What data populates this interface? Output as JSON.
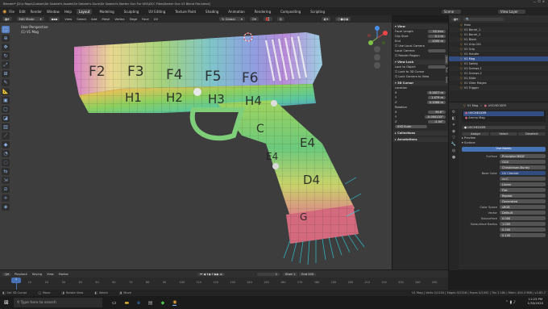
{
  "window": {
    "title": "Blender* [D:\\z Repo\\Custom\\Sir Gabriel's Assets\\Sir Gabriel's Guns\\Sir Gabriel's Starter Gun For UE4\\DCC Files\\Starter Gun V1 Blend File.blend]"
  },
  "menu": {
    "items": [
      "File",
      "Edit",
      "Render",
      "Window",
      "Help"
    ],
    "workspaces": [
      "Layout",
      "Modeling",
      "Sculpting",
      "UV Editing",
      "Texture Paint",
      "Shading",
      "Animation",
      "Rendering",
      "Compositing",
      "Scripting"
    ],
    "active_workspace": "Layout",
    "scene": "Scene",
    "view_layer": "View Layer"
  },
  "viewport_header": {
    "mode": "Edit Mode",
    "items": [
      "View",
      "Select",
      "Add",
      "Mesh",
      "Vertex",
      "Edge",
      "Face",
      "UV"
    ],
    "orientation": "Global"
  },
  "viewport": {
    "view_name": "User Perspective",
    "object_name": "(1) V1 Mag",
    "uv_labels": [
      "F2",
      "F3",
      "F4",
      "F5",
      "F6",
      "H1",
      "H2",
      "H3",
      "H4",
      "C",
      "E4",
      "D4",
      "E4",
      "G"
    ]
  },
  "npanel": {
    "view_section": "View",
    "focal_length_label": "Focal Length",
    "focal_length": "50 mm",
    "clip_start_label": "Clip Start",
    "clip_start": "0.1 m",
    "clip_end_label": "End",
    "clip_end": "1000 m",
    "local_camera_label": "Use Local Camera",
    "local_camera_field": "Local Camera",
    "render_region": "Render Region",
    "view_lock_section": "View Lock",
    "lock_to_object_label": "Lock to Object",
    "lock_3d_cursor": "Lock to 3D Cursor",
    "lock_camera_view": "Lock Camera to View",
    "cursor_section": "3D Cursor",
    "location_label": "Location",
    "loc": [
      [
        "X",
        "0.1827 m"
      ],
      [
        "Y",
        "1.479 m"
      ],
      [
        "Z",
        "0.1088 m"
      ]
    ],
    "rotation_label": "Rotation",
    "rot": [
      [
        "X",
        "90.8°"
      ],
      [
        "Y",
        "-0.000133°"
      ],
      [
        "Z",
        "-2.04°"
      ]
    ],
    "rotation_mode": "XYZ Euler",
    "collections": "Collections",
    "annotations": "Annotations",
    "tabs": [
      "Item",
      "Tool",
      "View"
    ]
  },
  "outliner": {
    "items": [
      "Halo",
      "V1 Barrel_1",
      "V1 Barrel_2",
      "V1 Block",
      "V1 Grip.001",
      "V1 Grip",
      "V1 Handle",
      "V1 Mag",
      "V1 Safety",
      "V1 Screws.1",
      "V1 Screws.2",
      "V1 Slide",
      "V1 Slide Ridges",
      "V1 Trigger"
    ],
    "selected": "V1 Mag"
  },
  "properties": {
    "object": "V1 Mag",
    "material_header": "UVCHECKER",
    "material_slots": [
      "UVCHECKER",
      "Ammo Mag"
    ],
    "material_name": "UVCHECKER",
    "assign_buttons": [
      "Assign",
      "Select",
      "Deselect"
    ],
    "preview": "Preview",
    "surface_section": "Surface",
    "use_nodes": "Use Nodes",
    "rows": [
      [
        "Surface",
        "Principled BSDF"
      ],
      [
        "",
        "GGX"
      ],
      [
        "",
        "Christensen-Burley"
      ],
      [
        "Base Color",
        "UV Checker"
      ],
      [
        "",
        "uv.C"
      ],
      [
        "",
        "Linear"
      ],
      [
        "",
        "Flat"
      ],
      [
        "",
        "Repeat"
      ],
      [
        "",
        "Generated"
      ],
      [
        "Color Space",
        "sRGB"
      ],
      [
        "Vector",
        "Default"
      ],
      [
        "Subsurface",
        "0.000"
      ],
      [
        "Subsurface Radius",
        "1.000"
      ],
      [
        "",
        "0.200"
      ],
      [
        "",
        "0.100"
      ]
    ]
  },
  "timeline": {
    "menus": [
      "Playback",
      "Keying",
      "View",
      "Marker"
    ],
    "frame": "1",
    "start_label": "Start",
    "start": "1",
    "end_label": "End",
    "end": "250",
    "ticks": [
      "10",
      "20",
      "30",
      "40",
      "50",
      "60",
      "70",
      "80",
      "90",
      "100",
      "110",
      "120",
      "130",
      "140",
      "150",
      "160",
      "170",
      "180",
      "190",
      "200",
      "210",
      "220",
      "230",
      "240",
      "250"
    ]
  },
  "statusbar": {
    "left": "Set 3D Cursor",
    "middle1": "Move",
    "middle2": "Rotate View",
    "middle3": "Select",
    "middle4": "Move",
    "stats": "V1 Mag | Verts 0/1234 | Edges 0/2318 | Faces 0/1092 | Tris 2.18k | Mem: 454.3 MiB | v2.82.7"
  },
  "taskbar": {
    "search_placeholder": "Type here to search",
    "time": "11:23 PM",
    "date": "1/30/2020"
  },
  "colors": {
    "accent": "#4772b3",
    "selection": "#334d80",
    "orange": "#e6a23c"
  }
}
